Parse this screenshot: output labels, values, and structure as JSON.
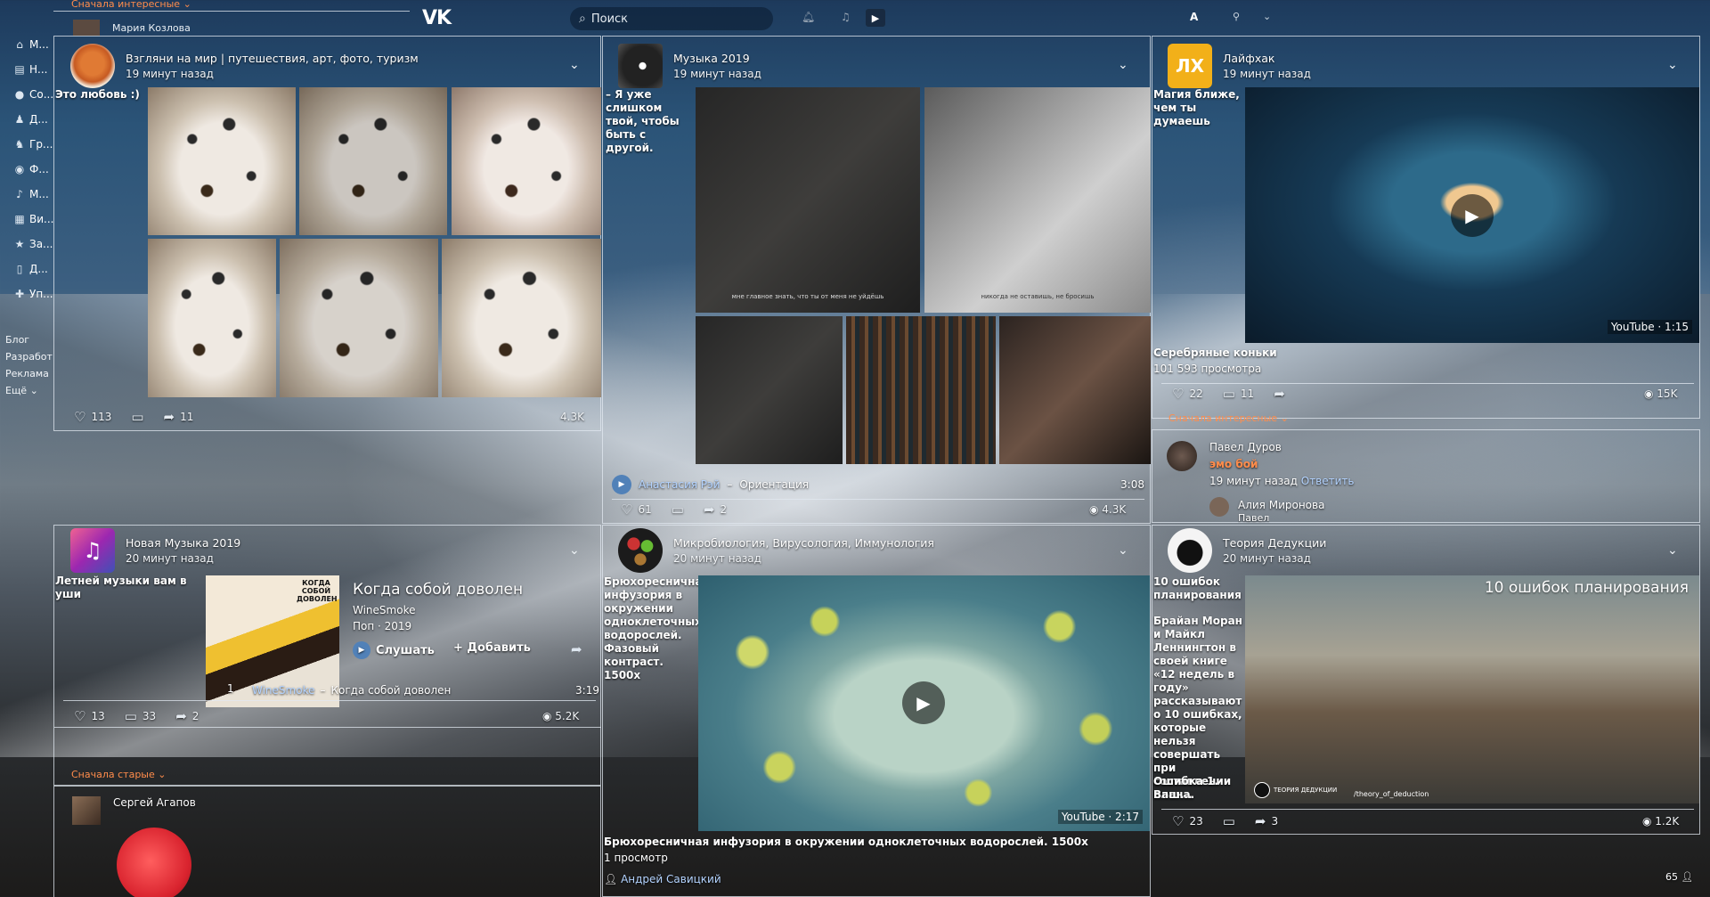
{
  "header": {
    "filter_top": "Сначала интересные",
    "logo": "VK",
    "search_placeholder": "Поиск",
    "user_initial": "A",
    "prev_user": "Мария Козлова"
  },
  "sidebar": {
    "items": [
      {
        "icon": "home-icon",
        "label": "М..."
      },
      {
        "icon": "news-icon",
        "label": "Н..."
      },
      {
        "icon": "messages-icon",
        "label": "Со..."
      },
      {
        "icon": "friends-icon",
        "label": "Д..."
      },
      {
        "icon": "groups-icon",
        "label": "Гр..."
      },
      {
        "icon": "photos-icon",
        "label": "Ф..."
      },
      {
        "icon": "music-icon",
        "label": "М..."
      },
      {
        "icon": "video-icon",
        "label": "Ви..."
      },
      {
        "icon": "bookmarks-icon",
        "label": "За..."
      },
      {
        "icon": "docs-icon",
        "label": "Д..."
      },
      {
        "icon": "games-icon",
        "label": "Уп..."
      }
    ],
    "footer": [
      "Блог",
      "Разработ",
      "Реклама",
      "Ещё"
    ]
  },
  "posts": [
    {
      "name": "Взгляни на мир | путешествия, арт, фото, туризм",
      "time": "19 минут назад",
      "text": "Это любовь :)",
      "likes": "113",
      "shares": "11",
      "views": "4.3K"
    },
    {
      "name": "Музыка 2019",
      "time": "19 минут назад",
      "text": "– Я уже слишком твой, чтобы быть с другой.",
      "captions": [
        "мне главное знать, что ты от меня не уйдёшь",
        "никогда не оставишь, не бросишь"
      ],
      "track_artist": "Анастасия Рэй",
      "track_sep": "–",
      "track_title": "Ориентация",
      "track_time": "3:08",
      "likes": "61",
      "shares": "2",
      "views": "4.3K"
    },
    {
      "name": "Лайфхак",
      "time": "19 минут назад",
      "text": "Магия ближе, чем ты думаешь",
      "video_badge": "YouTube · 1:15",
      "video_title": "Серебряные коньки",
      "video_views": "101 593 просмотра",
      "likes": "22",
      "comments": "11",
      "views": "15K",
      "comments_filter": "Сначала интересные",
      "comment_author": "Павел Дуров",
      "comment_text": "эмо бой",
      "comment_time": "19 минут назад",
      "comment_reply": "Ответить",
      "reply_author": "Алия Миронова",
      "reply_preview": "Павел"
    },
    {
      "name": "Новая Музыка 2019",
      "time": "20 минут назад",
      "text": "Летней музыки вам в уши",
      "album_cover_text": "КОГДА СОБОЙ ДОВОЛЕН",
      "album_title": "Когда собой доволен",
      "album_artist": "WineSmoke",
      "album_meta": "Поп · 2019",
      "listen": "Слушать",
      "add": "Добавить",
      "track_num": "1",
      "track_artist": "WineSmoke",
      "track_sep": "–",
      "track_title": "Когда собой доволен",
      "track_time": "3:19",
      "likes": "13",
      "comments": "33",
      "shares": "2",
      "views": "5.2K",
      "comments_filter": "Сначала старые",
      "commenter": "Сергей Агапов"
    },
    {
      "name": "Микробиология, Вирусология, Иммунология",
      "time": "20 минут назад",
      "text": "Брюхоресничная инфузория в окружении одноклеточных водорослей. Фазовый контраст. 1500х",
      "video_badge": "YouTube · 2:17",
      "video_title": "Брюхоресничная инфузория в окружении одноклеточных водорослей. 1500х",
      "video_views": "1 просмотр",
      "author": "Андрей Савицкий"
    },
    {
      "name": "Теория Дедукции",
      "time": "20 минут назад",
      "text_title": "10 ошибок планирования",
      "text": "Брайан Моран и Майкл Леннингтон в своей книге «12 недель в году» рассказывают о 10 ошибках, которые нельзя совершать при составлении плана.",
      "text_more": "Ошибка 1. Ваш...",
      "image_title": "10 ошибок планирования",
      "image_brand": "ТЕОРИЯ ДЕДУКЦИИ",
      "image_handle": "/theory_of_deduction",
      "likes": "23",
      "shares": "3",
      "views": "1.2K"
    }
  ],
  "footer_count": "65"
}
